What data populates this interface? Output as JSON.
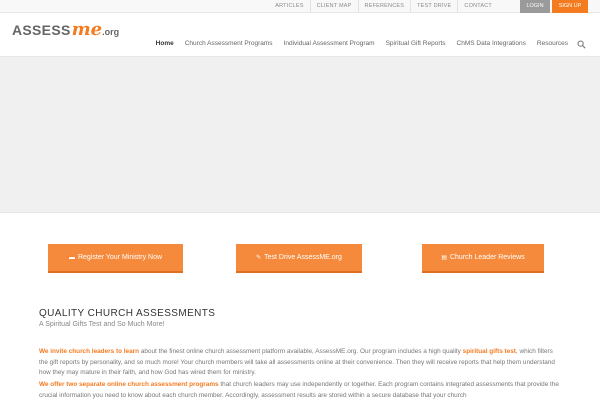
{
  "topbar": {
    "links": [
      "ARTICLES",
      "CLIENT MAP",
      "REFERENCES",
      "TEST DRIVE",
      "CONTACT"
    ],
    "login": "LOGIN",
    "signup": "SIGN UP"
  },
  "logo": {
    "assess": "ASSESS",
    "me": "me",
    "org": ".org"
  },
  "nav": {
    "items": [
      "Home",
      "Church Assessment Programs",
      "Individual Assessment Program",
      "Spiritual Gift Reports",
      "ChMS Data Integrations",
      "Resources"
    ]
  },
  "cta": {
    "register": "Register Your Ministry Now",
    "testdrive": "Test Drive AssessME.org",
    "reviews": "Church Leader Reviews"
  },
  "section": {
    "title": "QUALITY CHURCH ASSESSMENTS",
    "subtitle": "A Spiritual Gifts Test and So Much More!"
  },
  "para1": {
    "lead": "We invite church leaders to learn",
    "text_a": " about the finest online church assessment platform available, AssessME.org. Our program includes a high quality ",
    "highlight": "spiritual gifts test",
    "text_b": ", which filters the gift reports by personality, and so much more! Your church members will take all assessments online at their convenience. Then they will receive reports that help them understand how they may mature in their faith, and how God has wired them for ministry."
  },
  "para2": {
    "lead": "We offer two separate online church assessment programs",
    "text": " that church leaders may use independently or together. Each program contains integrated assessments that provide the crucial information you need to know about each church member.  Accordingly, assessment results are stored within a secure database that your church"
  },
  "colors": {
    "accent": "#f47b20",
    "button": "#f58a3c",
    "login": "#9a9a9a"
  }
}
